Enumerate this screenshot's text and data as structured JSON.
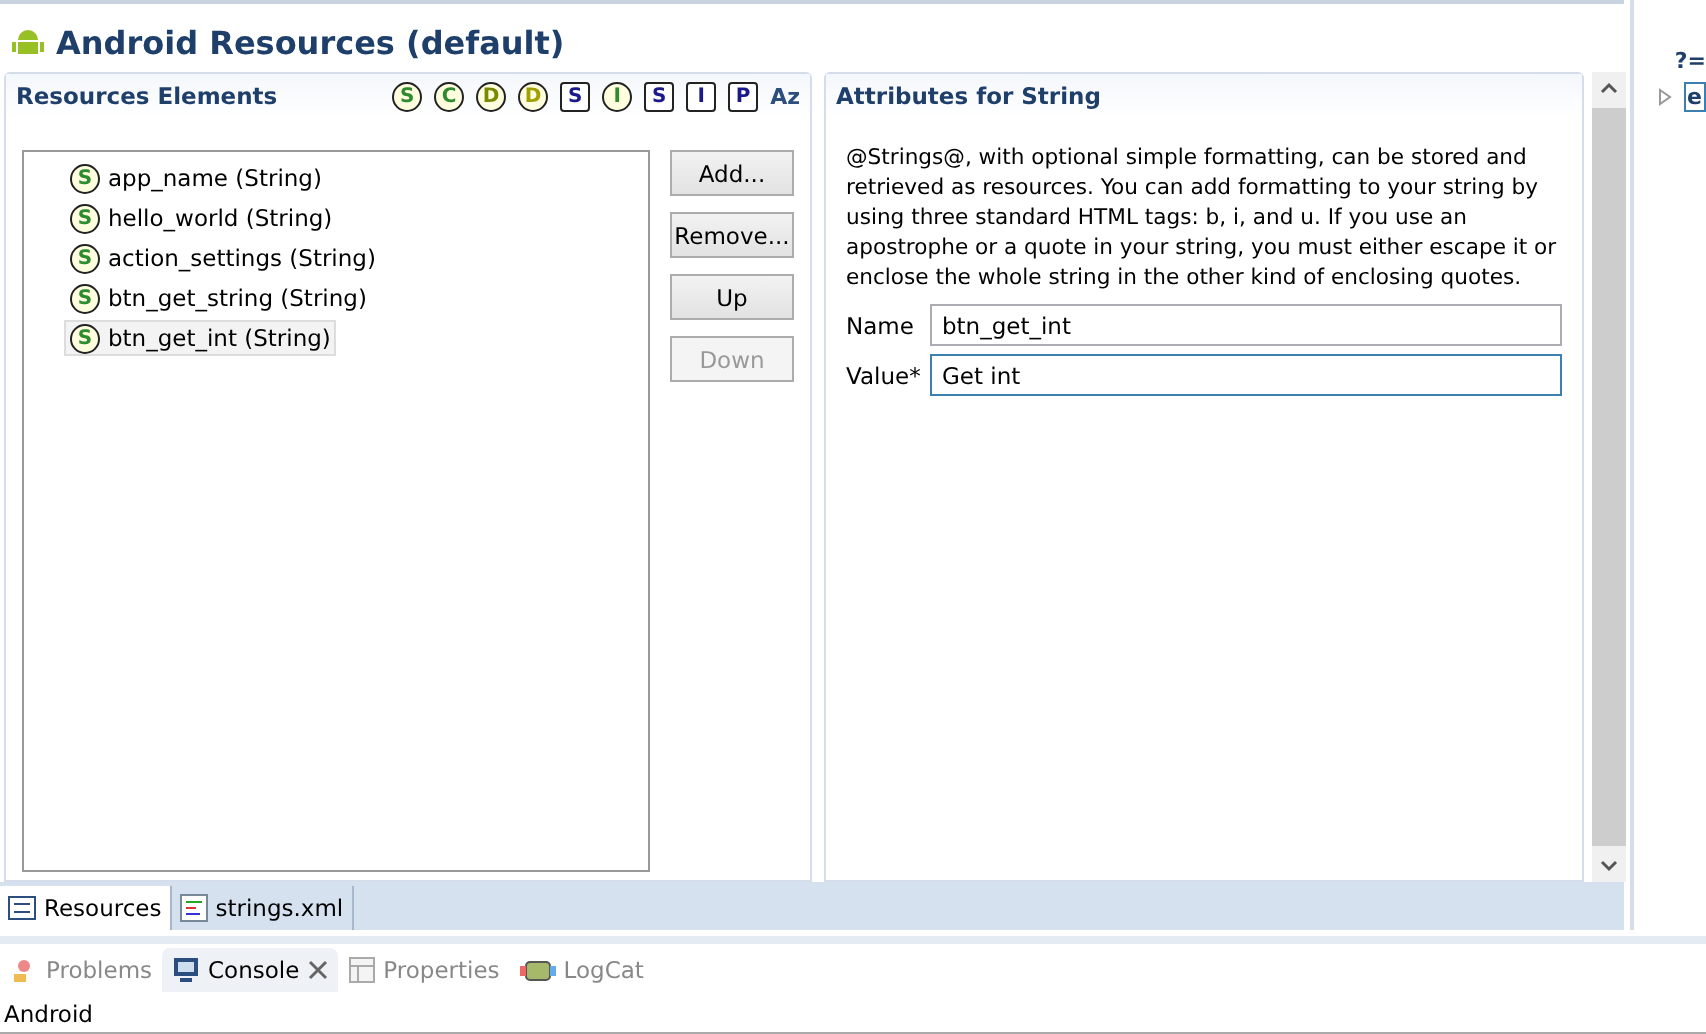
{
  "editor": {
    "title": "Android Resources (default)"
  },
  "resources_panel": {
    "title": "Resources Elements",
    "filters": [
      {
        "label": "S",
        "kind": "circle",
        "color": "#2e8b2e"
      },
      {
        "label": "C",
        "kind": "circle",
        "color": "#2e8b2e"
      },
      {
        "label": "D",
        "kind": "circle",
        "color": "#7a8a00"
      },
      {
        "label": "D",
        "kind": "circle",
        "color": "#a0a000"
      },
      {
        "label": "S",
        "kind": "square",
        "color": "#1a1a8c"
      },
      {
        "label": "I",
        "kind": "circle",
        "color": "#2e8b2e"
      },
      {
        "label": "S",
        "kind": "square",
        "color": "#1a1a8c"
      },
      {
        "label": "I",
        "kind": "square",
        "color": "#1a1a8c"
      },
      {
        "label": "P",
        "kind": "square",
        "color": "#1a1a8c"
      },
      {
        "label": "Az",
        "kind": "sort",
        "color": "#2b4e7e"
      }
    ],
    "items": [
      {
        "icon": "S",
        "label": "app_name (String)",
        "selected": false
      },
      {
        "icon": "S",
        "label": "hello_world (String)",
        "selected": false
      },
      {
        "icon": "S",
        "label": "action_settings (String)",
        "selected": false
      },
      {
        "icon": "S",
        "label": "btn_get_string (String)",
        "selected": false
      },
      {
        "icon": "S",
        "label": "btn_get_int (String)",
        "selected": true
      }
    ],
    "buttons": [
      {
        "label": "Add...",
        "disabled": false
      },
      {
        "label": "Remove...",
        "disabled": false
      },
      {
        "label": "Up",
        "disabled": false
      },
      {
        "label": "Down",
        "disabled": true
      }
    ]
  },
  "attributes_panel": {
    "title": "Attributes for String",
    "description": "@Strings@, with optional simple formatting, can be stored and retrieved as resources. You can add formatting to your string by using three standard HTML tags: b, i, and u. If you use an apostrophe or a quote in your string, you must either escape it or enclose the whole string in the other kind of enclosing quotes.",
    "fields": [
      {
        "label": "Name",
        "value": "btn_get_int",
        "focused": false
      },
      {
        "label": "Value*",
        "value": "Get int",
        "focused": true
      }
    ]
  },
  "editor_tabs": [
    {
      "label": "Resources",
      "kind": "form",
      "selected": true
    },
    {
      "label": "strings.xml",
      "kind": "xml",
      "selected": false
    }
  ],
  "outline": {
    "toolbar_label": "?=",
    "node": "e"
  },
  "view_tabs": [
    {
      "label": "Problems",
      "kind": "problems",
      "selected": false,
      "closable": false
    },
    {
      "label": "Console",
      "kind": "console",
      "selected": true,
      "closable": true
    },
    {
      "label": "Properties",
      "kind": "properties",
      "selected": false,
      "closable": false
    },
    {
      "label": "LogCat",
      "kind": "logcat",
      "selected": false,
      "closable": false
    }
  ],
  "console": {
    "text": "Android"
  }
}
